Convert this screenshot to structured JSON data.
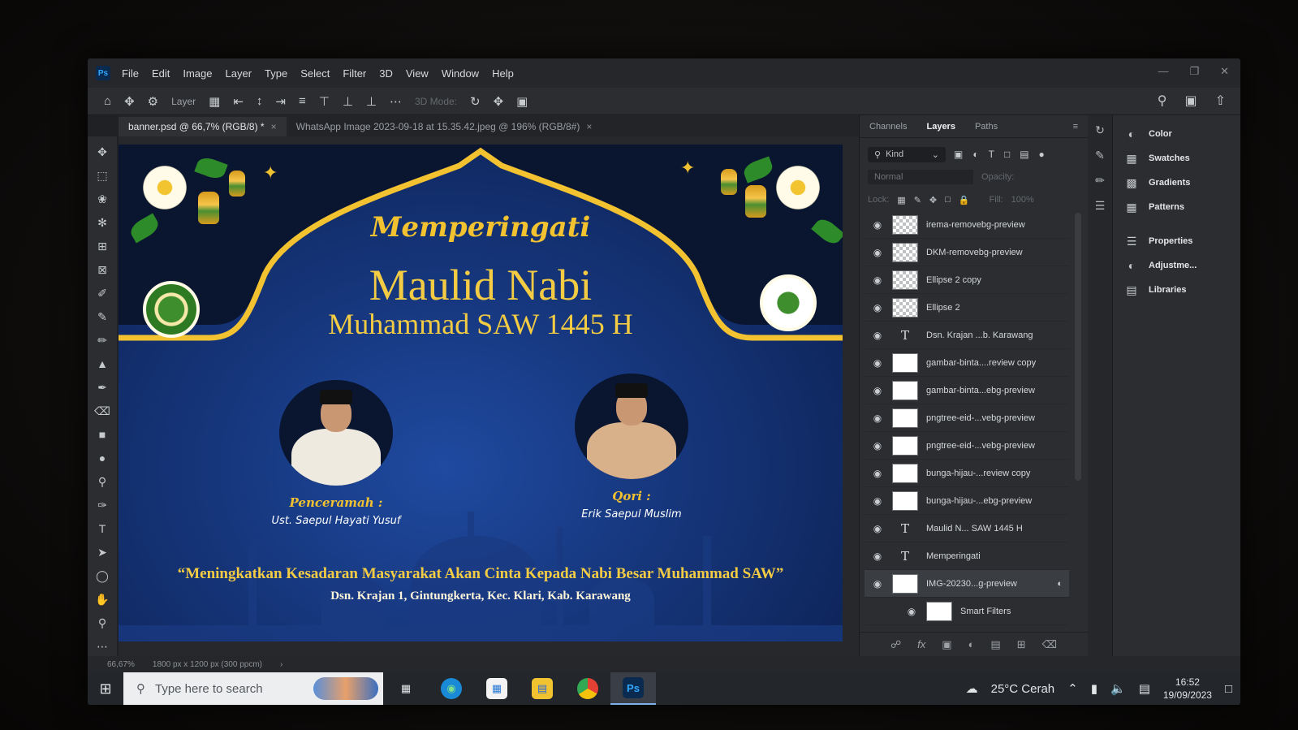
{
  "menubar": {
    "logo": "Ps",
    "items": [
      "File",
      "Edit",
      "Image",
      "Layer",
      "Type",
      "Select",
      "Filter",
      "3D",
      "View",
      "Window",
      "Help"
    ]
  },
  "options_bar": {
    "layer_select": "Layer",
    "three_d_mode": "3D Mode:"
  },
  "doc_tabs": [
    {
      "label": "banner.psd @ 66,7% (RGB/8) *",
      "close": "×"
    },
    {
      "label": "WhatsApp Image 2023-09-18 at 15.35.42.jpeg @ 196% (RGB/8#)",
      "close": "×"
    }
  ],
  "banner": {
    "headline_1": "Memperingati",
    "headline_2": "Maulid Nabi",
    "headline_3": "Muhammad SAW 1445 H",
    "speaker_role": "Penceramah :",
    "speaker_name": "Ust. Saepul Hayati Yusuf",
    "reciter_role": "Qori :",
    "reciter_name": "Erik Saepul Muslim",
    "quote": "“Meningkatkan Kesadaran Masyarakat Akan Cinta Kepada Nabi Besar Muhammad SAW”",
    "address": "Dsn. Krajan 1, Gintungkerta, Kec. Klari, Kab. Karawang"
  },
  "status": {
    "zoom": "66,67%",
    "doc_size": "1800 px x 1200 px (300 ppcm)"
  },
  "layers_panel": {
    "tabs": [
      "Channels",
      "Layers",
      "Paths"
    ],
    "active_tab": "Layers",
    "kind_label": "Kind",
    "blend_mode": "Normal",
    "opacity_label": "Opacity:",
    "lock_label": "Lock:",
    "fill_label": "Fill:",
    "fill_value": "100%",
    "layers": [
      {
        "name": "irema-removebg-preview",
        "kind": "image"
      },
      {
        "name": "DKM-removebg-preview",
        "kind": "image"
      },
      {
        "name": "Ellipse 2 copy",
        "kind": "shape"
      },
      {
        "name": "Ellipse 2",
        "kind": "shape"
      },
      {
        "name": "Dsn. Krajan ...b. Karawang",
        "kind": "text"
      },
      {
        "name": "gambar-binta....review copy",
        "kind": "smart"
      },
      {
        "name": "gambar-binta...ebg-preview",
        "kind": "smart"
      },
      {
        "name": "pngtree-eid-...vebg-preview",
        "kind": "smart"
      },
      {
        "name": "pngtree-eid-...vebg-preview",
        "kind": "smart"
      },
      {
        "name": "bunga-hijau-...review copy",
        "kind": "smart"
      },
      {
        "name": "bunga-hijau-...ebg-preview",
        "kind": "smart"
      },
      {
        "name": "Maulid N... SAW 1445 H",
        "kind": "text"
      },
      {
        "name": "Memperingati",
        "kind": "text"
      },
      {
        "name": "IMG-20230...g-preview",
        "kind": "smart"
      },
      {
        "name": "Smart Filters",
        "kind": "filter"
      }
    ]
  },
  "quick_panels": [
    "Color",
    "Swatches",
    "Gradients",
    "Patterns",
    "Properties",
    "Adjustme...",
    "Libraries"
  ],
  "taskbar": {
    "search_placeholder": "Type here to search",
    "weather": "25°C  Cerah",
    "time": "16:52",
    "date": "19/09/2023"
  }
}
